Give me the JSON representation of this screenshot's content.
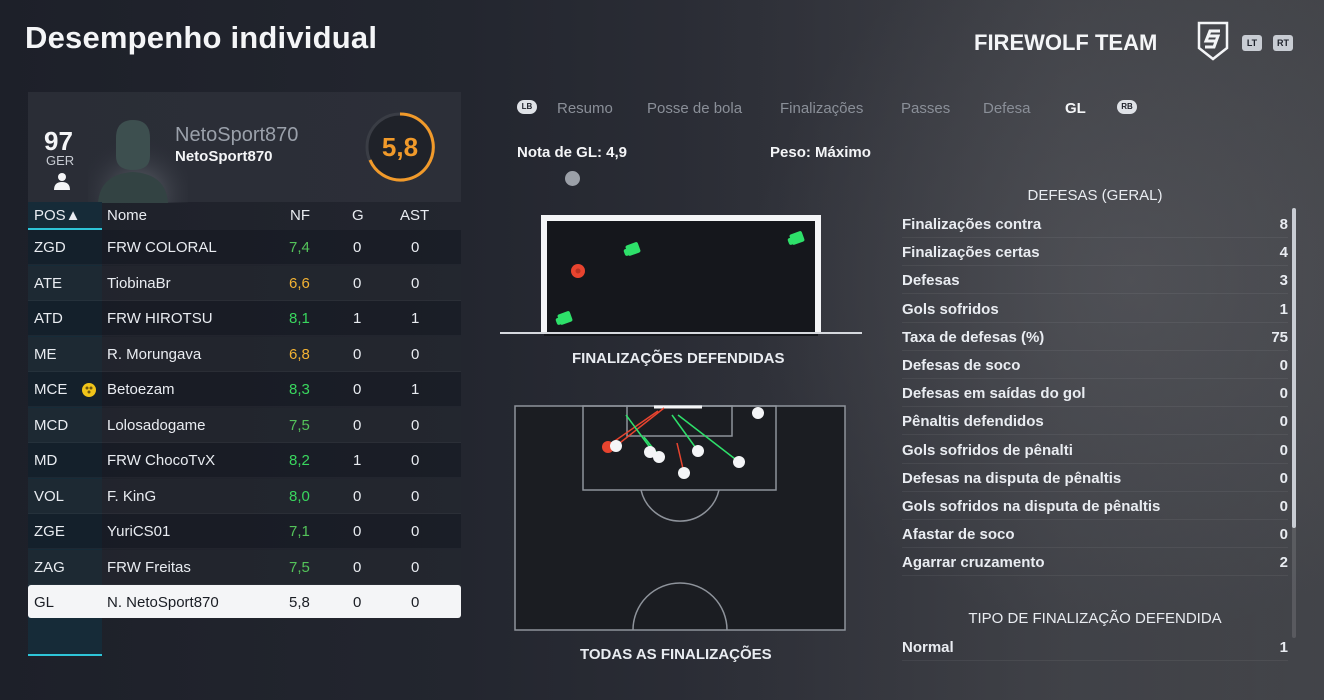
{
  "header": {
    "title": "Desempenho individual",
    "team": "FIREWOLF TEAM",
    "lt_label": "LT",
    "rt_label": "RT"
  },
  "player": {
    "overall": "97",
    "position": "GER",
    "name_large": "NetoSport870",
    "name_small": "NetoSport870",
    "match_rating": "5,8"
  },
  "table": {
    "headers": {
      "pos": "POS▲",
      "name": "Nome",
      "nf": "NF",
      "g": "G",
      "ast": "AST"
    },
    "rows": [
      {
        "pos": "ZGD",
        "name": "FRW COLORAL",
        "nf": "7,4",
        "g": "0",
        "ast": "0",
        "nf_color": "#54c35a"
      },
      {
        "pos": "ATE",
        "name": "TiobinaBr",
        "nf": "6,6",
        "g": "0",
        "ast": "0",
        "nf_color": "#f3b233"
      },
      {
        "pos": "ATD",
        "name": "FRW HIROTSU",
        "nf": "8,1",
        "g": "1",
        "ast": "1",
        "nf_color": "#39d65e"
      },
      {
        "pos": "ME",
        "name": "R. Morungava",
        "nf": "6,8",
        "g": "0",
        "ast": "0",
        "nf_color": "#f3b233"
      },
      {
        "pos": "MCE",
        "name": "Betoezam",
        "nf": "8,3",
        "g": "0",
        "ast": "1",
        "nf_color": "#39d65e"
      },
      {
        "pos": "MCD",
        "name": "Lolosadogame",
        "nf": "7,5",
        "g": "0",
        "ast": "0",
        "nf_color": "#54c35a"
      },
      {
        "pos": "MD",
        "name": "FRW ChocoTvX",
        "nf": "8,2",
        "g": "1",
        "ast": "0",
        "nf_color": "#39d65e"
      },
      {
        "pos": "VOL",
        "name": "F. KinG",
        "nf": "8,0",
        "g": "0",
        "ast": "0",
        "nf_color": "#39d65e"
      },
      {
        "pos": "ZGE",
        "name": "YuriCS01",
        "nf": "7,1",
        "g": "0",
        "ast": "0",
        "nf_color": "#54c35a"
      },
      {
        "pos": "ZAG",
        "name": "FRW Freitas",
        "nf": "7,5",
        "g": "0",
        "ast": "0",
        "nf_color": "#54c35a"
      },
      {
        "pos": "GL",
        "name": "N. NetoSport870",
        "nf": "5,8",
        "g": "0",
        "ast": "0",
        "nf_color": "#1a1d24"
      }
    ]
  },
  "tabs": {
    "lb": "LB",
    "rb": "RB",
    "items": [
      "Resumo",
      "Posse de bola",
      "Finalizações",
      "Passes",
      "Defesa",
      "GL"
    ],
    "active": "GL"
  },
  "gk": {
    "rating_label": "Nota de GL: 4,9",
    "weight_label": "Peso: Máximo",
    "saved_caption": "FINALIZAÇÕES DEFENDIDAS",
    "all_caption": "TODAS AS FINALIZAÇÕES"
  },
  "stats": {
    "title": "DEFESAS (GERAL)",
    "rows": [
      {
        "label": "Finalizações contra",
        "value": "8"
      },
      {
        "label": "Finalizações certas",
        "value": "4"
      },
      {
        "label": "Defesas",
        "value": "3"
      },
      {
        "label": "Gols sofridos",
        "value": "1"
      },
      {
        "label": "Taxa de defesas (%)",
        "value": "75"
      },
      {
        "label": "Defesas de soco",
        "value": "0"
      },
      {
        "label": "Defesas em saídas do gol",
        "value": "0"
      },
      {
        "label": "Pênaltis defendidos",
        "value": "0"
      },
      {
        "label": "Gols sofridos de pênalti",
        "value": "0"
      },
      {
        "label": "Defesas na disputa de pênaltis",
        "value": "0"
      },
      {
        "label": "Gols sofridos na disputa de pênaltis",
        "value": "0"
      },
      {
        "label": "Afastar de soco",
        "value": "0"
      },
      {
        "label": "Agarrar cruzamento",
        "value": "2"
      }
    ],
    "type_title": "TIPO DE FINALIZAÇÃO DEFENDIDA",
    "type_rows": [
      {
        "label": "Normal",
        "value": "1"
      }
    ]
  },
  "colors": {
    "accent_cyan": "#2ec5d8",
    "rating_orange": "#f19a2a",
    "save_green": "#2ee06a",
    "goal_red": "#e8442f"
  }
}
